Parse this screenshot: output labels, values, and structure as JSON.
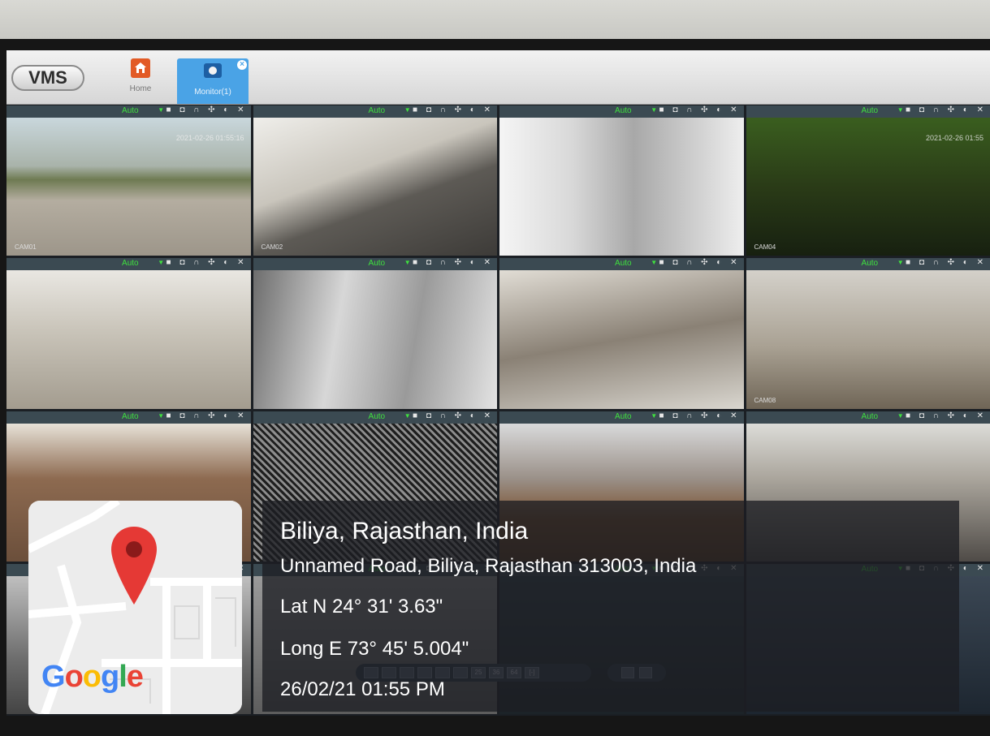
{
  "app": {
    "logo": "VMS",
    "tabs": [
      {
        "label": "Home",
        "icon": "home-icon"
      },
      {
        "label": "Monitor(1)",
        "icon": "monitor-icon",
        "close": "×"
      }
    ]
  },
  "tile_controls": {
    "mode": "Auto",
    "tools": "■ ◘ ∩ ✣ ◐ ✕"
  },
  "feeds": [
    {
      "label": "CAM01",
      "time": "2021-02-26 01:55:16"
    },
    {
      "label": "CAM02",
      "time": ""
    },
    {
      "label": "",
      "time": ""
    },
    {
      "label": "CAM04",
      "time": "2021-02-26 01:55"
    },
    {
      "label": "",
      "time": ""
    },
    {
      "label": "",
      "time": ""
    },
    {
      "label": "",
      "time": ""
    },
    {
      "label": "CAM08",
      "time": ""
    },
    {
      "label": "",
      "time": ""
    },
    {
      "label": "",
      "time": ""
    },
    {
      "label": "",
      "time": ""
    },
    {
      "label": "",
      "time": ""
    },
    {
      "label": "",
      "time": ""
    },
    {
      "label": "",
      "time": ""
    },
    {
      "label": "",
      "time": ""
    },
    {
      "label": "",
      "time": ""
    }
  ],
  "layout_bar": {
    "buttons": [
      "",
      "",
      "",
      "",
      "",
      "",
      "25",
      "36",
      "64",
      "[-]"
    ]
  },
  "geo_overlay": {
    "place": "Biliya, Rajasthan, India",
    "address": "Unnamed Road, Biliya, Rajasthan 313003, India",
    "lat": "Lat N 24° 31' 3.63\"",
    "long": "Long E 73° 45' 5.004\"",
    "datetime": "26/02/21 01:55 PM"
  },
  "map": {
    "brand_letters": [
      "G",
      "o",
      "o",
      "g",
      "l",
      "e"
    ],
    "pin_color": "#e53935"
  }
}
